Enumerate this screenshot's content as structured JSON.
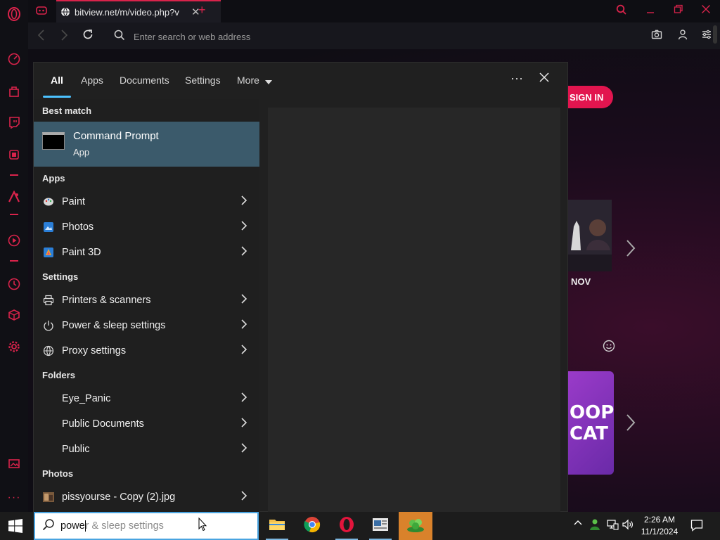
{
  "browser": {
    "tab_title": "bitview.net/m/video.php?v",
    "tab_close": "✕",
    "new_tab": "+",
    "address_placeholder": "Enter search or web address"
  },
  "webpage": {
    "signin_label": "SIGN IN",
    "thumb1_label": "NOV",
    "thumb2_line1": "OOP",
    "thumb2_line2": "CAT"
  },
  "search": {
    "tabs": [
      "All",
      "Apps",
      "Documents",
      "Settings",
      "More"
    ],
    "active_tab": "All",
    "more_options": "···",
    "best_match": {
      "heading": "Best match",
      "title": "Command Prompt",
      "subtitle": "App"
    },
    "apps": {
      "heading": "Apps",
      "items": [
        "Paint",
        "Photos",
        "Paint 3D"
      ]
    },
    "settings": {
      "heading": "Settings",
      "items": [
        "Printers & scanners",
        "Power & sleep settings",
        "Proxy settings"
      ]
    },
    "folders": {
      "heading": "Folders",
      "items": [
        "Eye_Panic",
        "Public Documents",
        "Public"
      ]
    },
    "photos": {
      "heading": "Photos",
      "items": [
        "pissyourse - Copy (2).jpg"
      ]
    }
  },
  "taskbar": {
    "search_typed": "powe",
    "search_suggestion": "r & sleep settings",
    "clock_time": "2:26 AM",
    "clock_date": "11/1/2024",
    "apps": [
      "file-explorer",
      "chrome",
      "opera",
      "news-app",
      "game-app"
    ]
  }
}
